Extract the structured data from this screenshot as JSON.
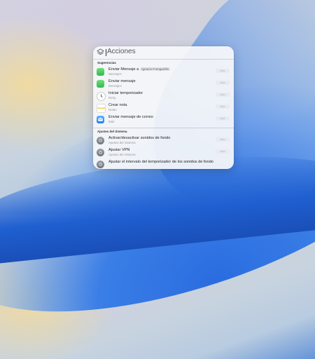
{
  "search": {
    "placeholder": "Acciones"
  },
  "sections": [
    {
      "label": "Sugerencias"
    },
    {
      "label": "Ajustes del Sistema"
    }
  ],
  "rows": [
    {
      "title": "Enviar Mensaje a",
      "chip": "Ignacio Franganillo",
      "subtitle": "Mensajes",
      "badge": "Atajo",
      "icon": "messages-icon"
    },
    {
      "title": "Enviar mensaje",
      "subtitle": "Mensajes",
      "badge": "Atajo",
      "icon": "messages-icon"
    },
    {
      "title": "Iniciar temporizador",
      "subtitle": "Reloj",
      "badge": "Atajo",
      "icon": "clock-icon"
    },
    {
      "title": "Crear nota",
      "subtitle": "Notas",
      "badge": "Atajo",
      "icon": "notes-icon"
    },
    {
      "title": "Enviar mensaje de correo",
      "subtitle": "Mail",
      "badge": "Atajo",
      "icon": "mail-icon"
    },
    {
      "title": "Activar/desactivar sonidos de fondo",
      "subtitle": "Ajustes del Sistema",
      "badge": "Atajo",
      "icon": "settings-icon"
    },
    {
      "title": "Ajustar VPN",
      "subtitle": "Ajustes del Sistema",
      "badge": "Atajo",
      "icon": "settings-icon"
    },
    {
      "title": "Ajustar el intervalo del temporizador de los sonidos de fondo",
      "subtitle": "",
      "badge": "",
      "icon": "settings-icon"
    }
  ]
}
